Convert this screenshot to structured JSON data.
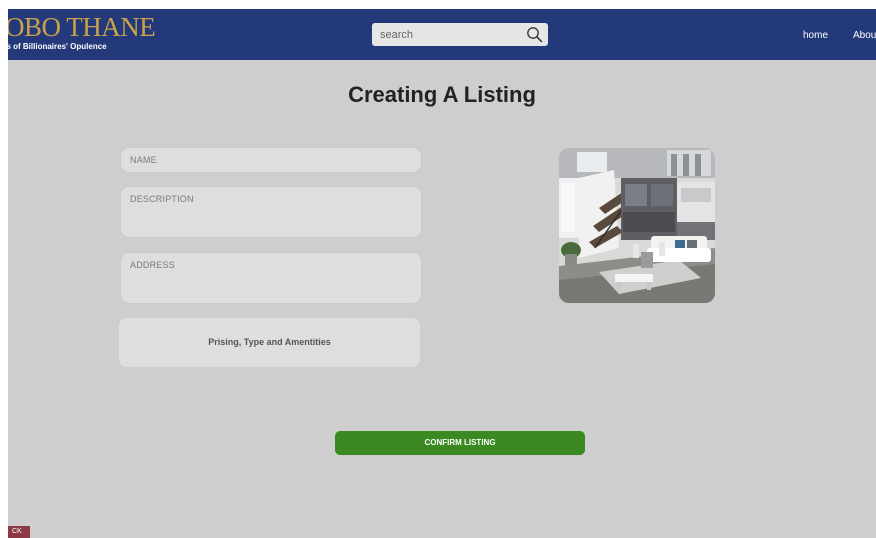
{
  "header": {
    "brand_title": "OBO THANE",
    "brand_tagline": "es of Billionaires' Opulence",
    "search": {
      "placeholder": "search",
      "value": ""
    },
    "nav": [
      {
        "label": "home"
      },
      {
        "label": "Abou"
      }
    ]
  },
  "main": {
    "title": "Creating A Listing",
    "form": {
      "name_label": "NAME",
      "description_label": "DESCRIPTION",
      "address_label": "ADDRESS",
      "pricing_button_label": "Prising, Type and Amentities"
    },
    "confirm_label": "CONFIRM LISTING",
    "back_label": "CK"
  },
  "colors": {
    "header_bg": "#23397a",
    "brand_gold": "#c9a24a",
    "page_bg": "#cecece",
    "confirm_green": "#3b8a21",
    "back_red": "#8c3b46"
  }
}
